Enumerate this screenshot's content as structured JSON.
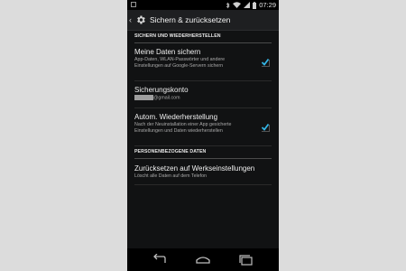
{
  "status_bar": {
    "time": "07:29",
    "icons": [
      "notification-icon",
      "bluetooth-icon",
      "wifi-icon",
      "signal-icon",
      "battery-icon"
    ]
  },
  "action_bar": {
    "title": "Sichern & zurücksetzen",
    "icon": "gear-icon"
  },
  "sections": {
    "backup_header": "SICHERN UND WIEDERHERSTELLEN",
    "personal_header": "PERSONENBEZOGENE DATEN"
  },
  "items": {
    "backup_data": {
      "title": "Meine Daten sichern",
      "summary": "App-Daten, WLAN-Passwörter und andere Einstellungen auf Google-Servern sichern",
      "checked": true
    },
    "backup_account": {
      "title": "Sicherungskonto",
      "summary": "@gmail.com"
    },
    "auto_restore": {
      "title": "Autom. Wiederherstellung",
      "summary": "Nach der Neuinstallation einer App gesicherte Einstellungen und Daten wiederherstellen",
      "checked": true
    },
    "factory_reset": {
      "title": "Zurücksetzen auf Werkseinstellungen",
      "summary": "Löscht alle Daten auf dem Telefon"
    }
  },
  "colors": {
    "accent": "#33b5e5",
    "background": "#111213",
    "page_background": "#dcdcdc"
  },
  "navigation": [
    "back-icon",
    "home-icon",
    "recents-icon"
  ]
}
